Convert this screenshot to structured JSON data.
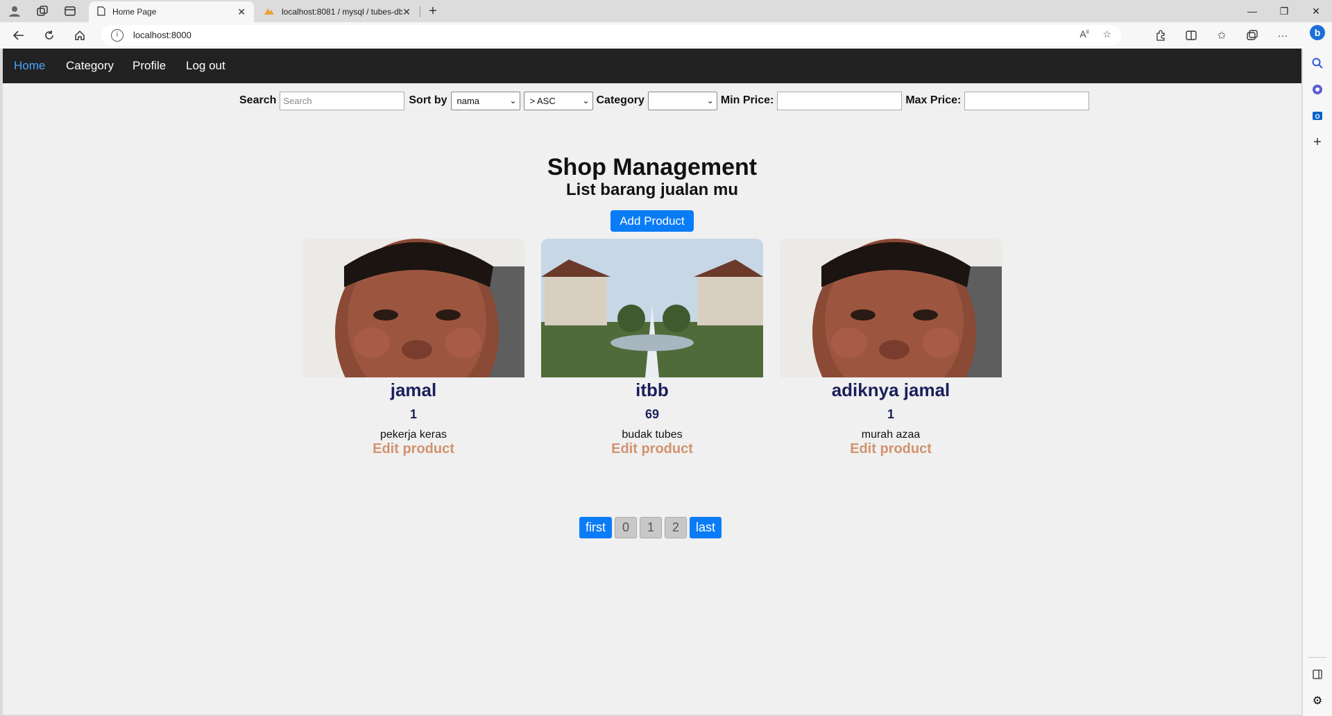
{
  "browser": {
    "tabs": [
      {
        "title": "Home Page"
      },
      {
        "title": "localhost:8081 / mysql / tubes-db"
      }
    ],
    "url": "localhost:8000"
  },
  "nav": {
    "items": [
      {
        "label": "Home"
      },
      {
        "label": "Category"
      },
      {
        "label": "Profile"
      },
      {
        "label": "Log out"
      }
    ]
  },
  "filters": {
    "search_label": "Search",
    "search_placeholder": "Search",
    "sort_label": "Sort by",
    "sort_value": "nama",
    "order_value": "> ASC",
    "category_label": "Category",
    "category_value": "",
    "min_label": "Min Price:",
    "max_label": "Max Price:"
  },
  "header": {
    "title": "Shop Management",
    "subtitle": "List barang jualan mu",
    "add_label": "Add Product"
  },
  "products": [
    {
      "name": "jamal",
      "qty": "1",
      "desc": "pekerja keras",
      "edit": "Edit product"
    },
    {
      "name": "itbb",
      "qty": "69",
      "desc": "budak tubes",
      "edit": "Edit product"
    },
    {
      "name": "adiknya jamal",
      "qty": "1",
      "desc": "murah azaa",
      "edit": "Edit product"
    }
  ],
  "pagination": {
    "first": "first",
    "pages": [
      "0",
      "1",
      "2"
    ],
    "last": "last"
  },
  "colors": {
    "accent": "#0a7cf7",
    "nav_bg": "#222222",
    "title_color": "#1a1f5c",
    "edit_color": "#d2936f"
  }
}
